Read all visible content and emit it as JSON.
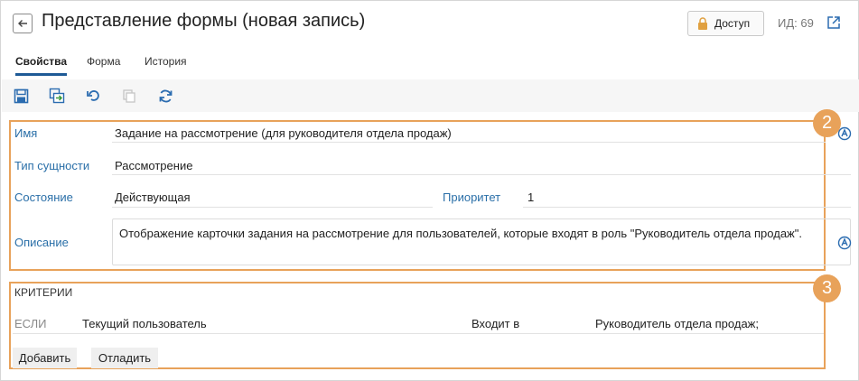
{
  "header": {
    "title": "Представление формы (новая запись)",
    "access_label": "Доступ",
    "id_label": "ИД: 69"
  },
  "tabs": [
    {
      "label": "Свойства",
      "active": true
    },
    {
      "label": "Форма",
      "active": false
    },
    {
      "label": "История",
      "active": false
    }
  ],
  "toolbar": {
    "icons": [
      "save-icon",
      "save-and-close-icon",
      "undo-icon",
      "copy-icon",
      "refresh-icon"
    ]
  },
  "badges": {
    "properties": "2",
    "criteria": "3"
  },
  "properties": {
    "name_label": "Имя",
    "name_value": "Задание на рассмотрение (для руководителя отдела продаж)",
    "entity_type_label": "Тип сущности",
    "entity_type_value": "Рассмотрение",
    "state_label": "Состояние",
    "state_value": "Действующая",
    "priority_label": "Приоритет",
    "priority_value": "1",
    "description_label": "Описание",
    "description_value": "Отображение карточки задания на рассмотрение для пользователей, которые входят в роль \"Руководитель отдела продаж\"."
  },
  "criteria": {
    "title": "КРИТЕРИИ",
    "row": {
      "condition": "ЕСЛИ",
      "subject": "Текущий пользователь",
      "operator": "Входит в",
      "value": "Руководитель отдела продаж;"
    },
    "add_label": "Добавить",
    "debug_label": "Отладить"
  },
  "colors": {
    "accent": "#1e5a96",
    "label": "#2a6fa8",
    "highlight": "#e8a25a",
    "toolbar_icon": "#2b6cb0"
  }
}
